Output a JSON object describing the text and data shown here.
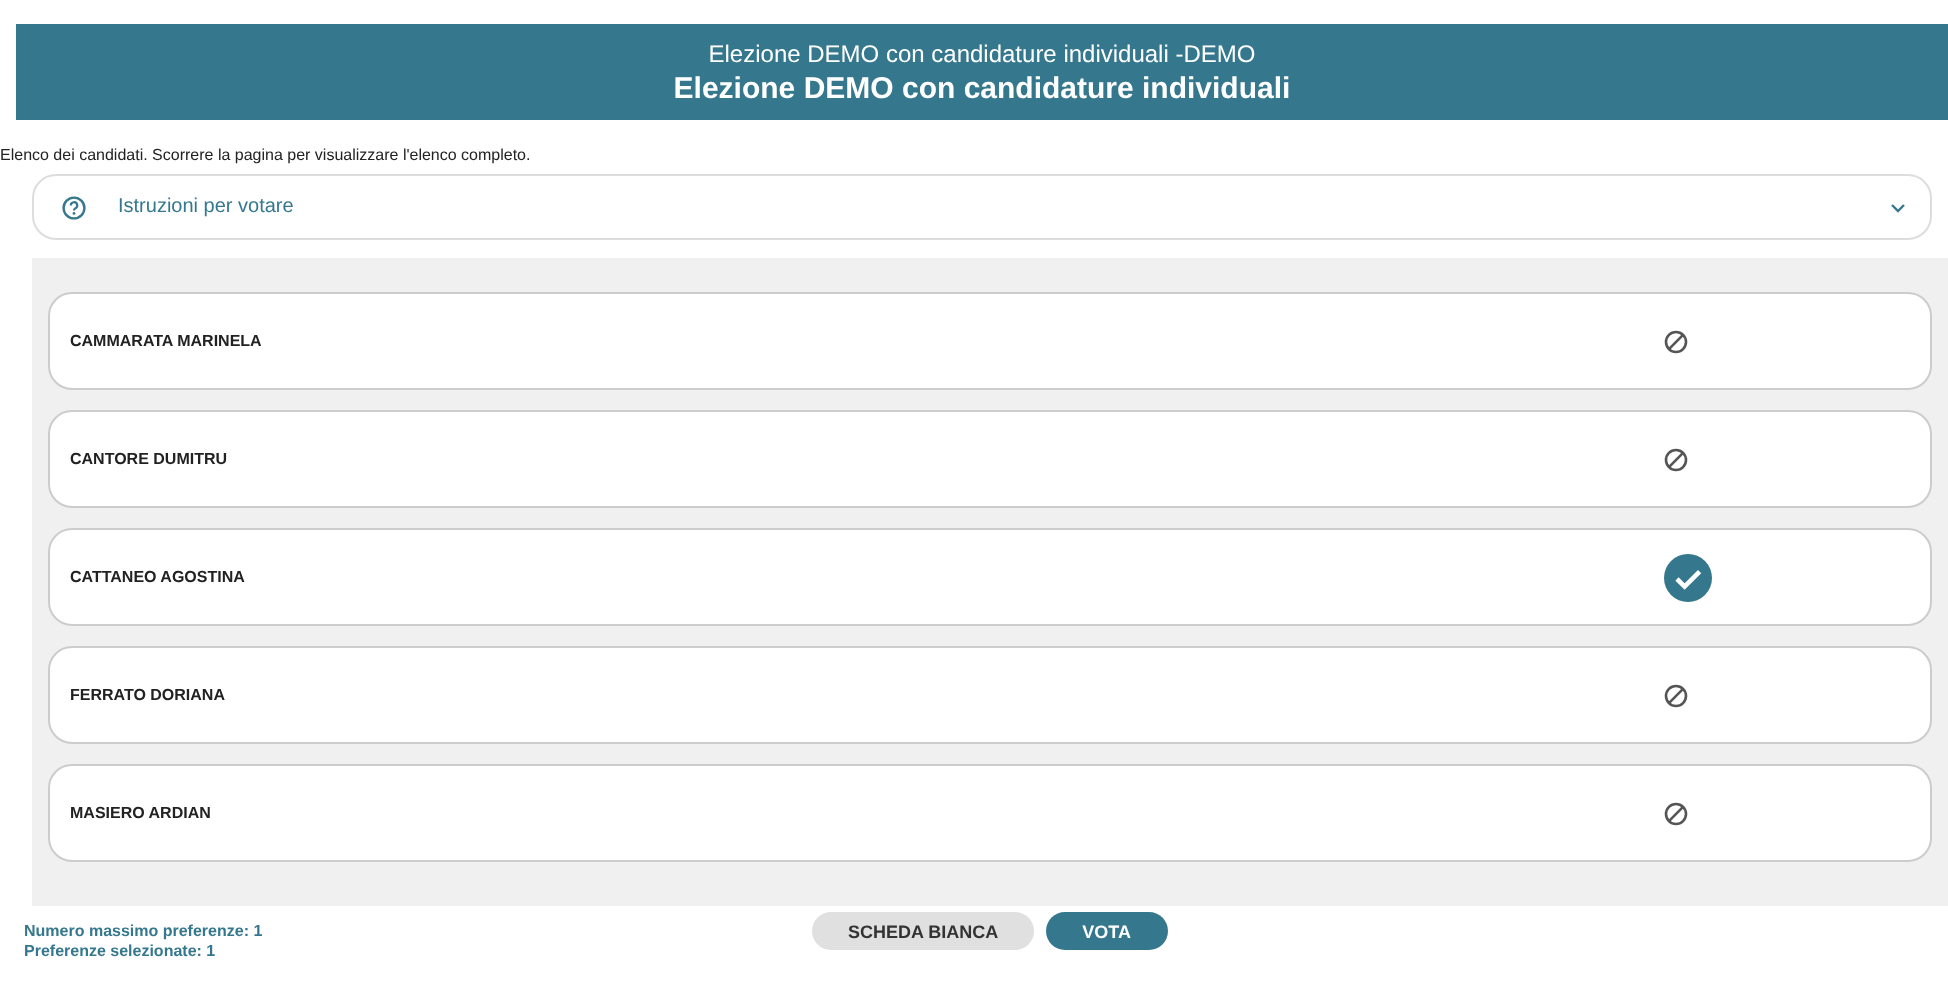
{
  "header": {
    "subtitle": "Elezione DEMO con candidature individuali -DEMO",
    "title": "Elezione DEMO con candidature individuali"
  },
  "intro": "Elenco dei candidati. Scorrere la pagina per visualizzare l'elenco completo.",
  "instructions": {
    "label": "Istruzioni per votare",
    "expanded": false
  },
  "candidates": [
    {
      "name": "CAMMARATA MARINELA",
      "selected": false
    },
    {
      "name": "CANTORE DUMITRU",
      "selected": false
    },
    {
      "name": "CATTANEO AGOSTINA",
      "selected": true
    },
    {
      "name": "FERRATO DORIANA",
      "selected": false
    },
    {
      "name": "MASIERO ARDIAN",
      "selected": false
    }
  ],
  "footer": {
    "max_preferences": "Numero massimo preferenze: 1",
    "selected_preferences": "Preferenze selezionate: 1"
  },
  "buttons": [
    {
      "label": "SCHEDA BIANCA",
      "kind": "secondary"
    },
    {
      "label": "VOTA",
      "kind": "primary"
    }
  ]
}
